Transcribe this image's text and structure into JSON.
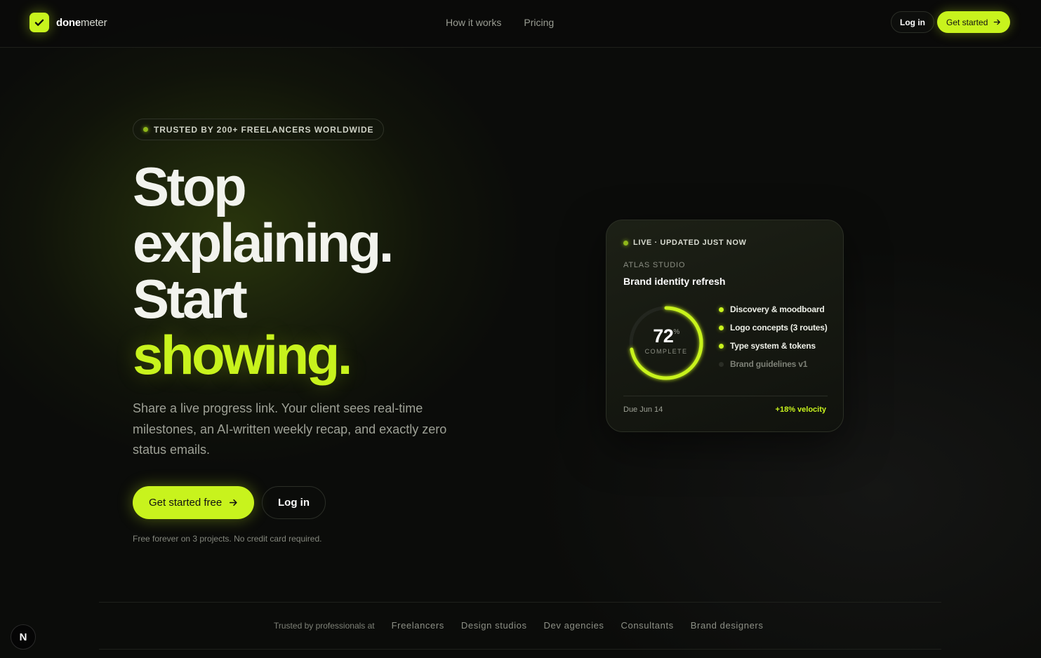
{
  "brand": {
    "name_bold": "done",
    "name_light": "meter"
  },
  "nav": {
    "links": [
      "How it works",
      "Pricing"
    ],
    "login_label": "Log in",
    "cta_label": "Get started"
  },
  "hero": {
    "badge": "TRUSTED BY 200+ FREELANCERS WORLDWIDE",
    "headline_line1": "Stop",
    "headline_line2": "explaining.",
    "headline_line3": "Start",
    "headline_line4": "showing.",
    "subtitle": "Share a live progress link. Your client sees real-time milestones, an AI-written weekly recap, and exactly zero status emails.",
    "cta_primary": "Get started free",
    "cta_secondary": "Log in",
    "fine_print": "Free forever on 3 projects. No credit card required."
  },
  "card": {
    "live_label": "LIVE · UPDATED JUST NOW",
    "client": "ATLAS STUDIO",
    "project": "Brand identity refresh",
    "progress_value": "72",
    "progress_unit": "%",
    "progress_fraction": 0.72,
    "progress_label": "COMPLETE",
    "milestones": [
      {
        "label": "Discovery & moodboard",
        "done": true
      },
      {
        "label": "Logo concepts (3 routes)",
        "done": true
      },
      {
        "label": "Type system & tokens",
        "done": true
      },
      {
        "label": "Brand guidelines v1",
        "done": false
      }
    ],
    "due": "Due Jun 14",
    "velocity": "+18% velocity"
  },
  "trust": {
    "lead": "Trusted by professionals at",
    "segments": [
      "Freelancers",
      "Design studios",
      "Dev agencies",
      "Consultants",
      "Brand designers"
    ]
  },
  "corner_badge": "N",
  "colors": {
    "accent": "#c8f31d",
    "background": "#0b0c0a"
  }
}
